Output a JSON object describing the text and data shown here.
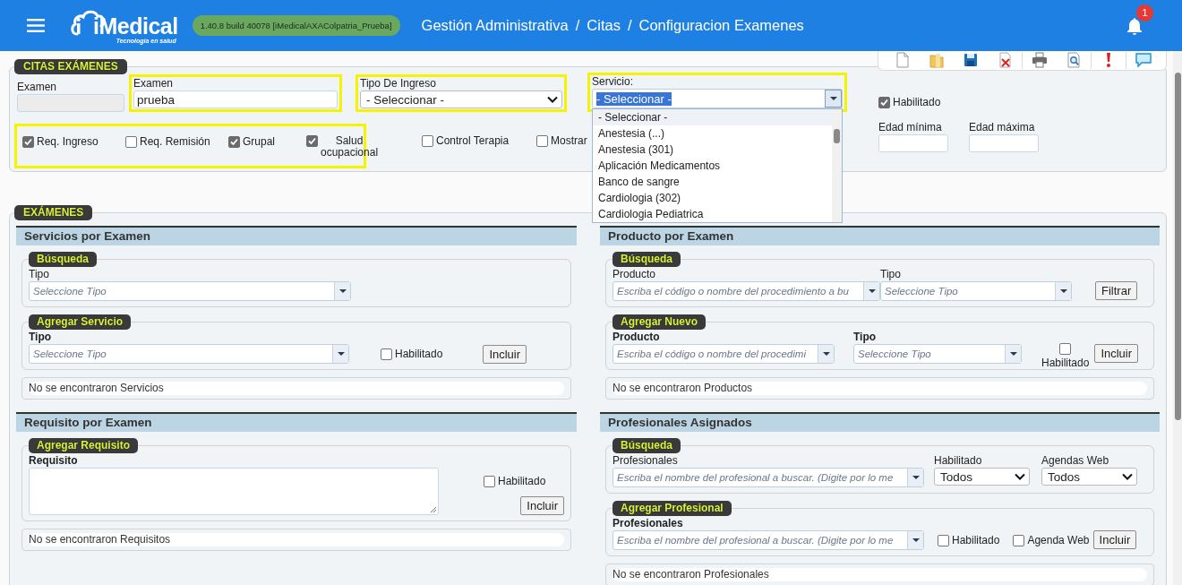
{
  "header": {
    "logo": "iMedical",
    "tagline": "Tecnología en salud",
    "version": "1.40.8 build 40078 [iMedicalAXAColpatria_Prueba]",
    "breadcrumb": [
      "Gestión Administrativa",
      "/",
      "Citas",
      "/",
      "Configuracion Examenes"
    ],
    "notification_count": "1"
  },
  "citas": {
    "legend": "CITAS EXÁMENES",
    "lines": [
      {
        "controls": [
          {
            "kind": "text",
            "label": "Examen",
            "disabled": true,
            "highlighted": false
          },
          {
            "kind": "text",
            "label": "Examen",
            "value": "prueba",
            "disabled": false,
            "highlighted": true
          },
          {
            "kind": "select",
            "label": "Tipo De Ingreso",
            "value": "- Seleccionar -",
            "highlighted": true
          },
          {
            "kind": "combo",
            "label": "Servicio:",
            "value": "- Seleccionar -",
            "text_selected": true,
            "highlighted": true,
            "expanded": true,
            "options": [
              {
                "label": "- Seleccionar -",
                "selected": true
              },
              {
                "label": "Anestesia (...)",
                "selected": false
              },
              {
                "label": "Anestesia (301)",
                "selected": false
              },
              {
                "label": "Aplicación Medicamentos",
                "selected": false
              },
              {
                "label": "Banco de sangre",
                "selected": false
              },
              {
                "label": "Cardiologia (302)",
                "selected": false
              },
              {
                "label": "Cardiologia Pediatrica",
                "selected": false
              }
            ]
          },
          {
            "kind": "check",
            "label": "Habilitado",
            "checked": true,
            "highlighted": false
          }
        ]
      },
      {
        "controls": [
          {
            "kind": "group",
            "highlighted": true,
            "items": [
              {
                "kind": "check",
                "label": "Req. Ingreso",
                "checked": true
              },
              {
                "kind": "check",
                "label": "Req. Remisión",
                "checked": false
              },
              {
                "kind": "check",
                "label": "Grupal",
                "checked": true
              },
              {
                "kind": "check",
                "label": "Salud ocupacional",
                "checked": true
              }
            ]
          },
          {
            "kind": "check",
            "label": "Control Terapia",
            "checked": false,
            "highlighted": false
          },
          {
            "kind": "check",
            "label": "Mostrar",
            "checked": false,
            "highlighted": false
          },
          {
            "kind": "text",
            "label": "Edad mínima",
            "disabled": false,
            "highlighted": false
          },
          {
            "kind": "text",
            "label": "Edad máxima",
            "disabled": false,
            "highlighted": false
          }
        ]
      }
    ]
  },
  "examenes": {
    "legend": "EXÁMENES",
    "columns": [
      [
        {
          "title": "Servicios por Examen",
          "groups": [
            {
              "legend": "Búsqueda",
              "kind": "search",
              "controls": [
                {
                  "kind": "combo",
                  "label": "Tipo",
                  "placeholder": "Seleccione Tipo",
                  "expanded": false
                }
              ]
            },
            {
              "legend": "Agregar Servicio",
              "kind": "add",
              "controls": [
                {
                  "kind": "combo",
                  "label": "Tipo",
                  "placeholder": "Seleccione Tipo",
                  "expanded": false
                },
                {
                  "kind": "check",
                  "label": "Habilitado",
                  "checked": false
                },
                {
                  "kind": "button",
                  "label": "Incluir"
                }
              ]
            }
          ],
          "result": "No se encontraron Servicios"
        },
        {
          "title": "Requisito por Examen",
          "groups": [
            {
              "legend": "Agregar Requisito",
              "kind": "add",
              "controls": [
                {
                  "kind": "textarea",
                  "label": "Requisito"
                },
                {
                  "kind": "check",
                  "label": "Habilitado",
                  "checked": false
                },
                {
                  "kind": "button",
                  "label": "Incluir"
                }
              ]
            }
          ],
          "result": "No se encontraron Requisitos"
        }
      ],
      [
        {
          "title": "Producto por Examen",
          "groups": [
            {
              "legend": "Búsqueda",
              "kind": "search",
              "controls": [
                {
                  "kind": "combo",
                  "label": "Producto",
                  "placeholder": "Escriba el código o nombre del procedimiento a bu",
                  "expanded": false
                },
                {
                  "kind": "combo",
                  "label": "Tipo",
                  "placeholder": "Seleccione Tipo",
                  "expanded": false
                },
                {
                  "kind": "button",
                  "label": "Filtrar"
                }
              ]
            },
            {
              "legend": "Agregar Nuevo",
              "kind": "add",
              "controls": [
                {
                  "kind": "combo",
                  "label": "Producto",
                  "placeholder": "Escriba el código o nombre del procedimi",
                  "expanded": false
                },
                {
                  "kind": "combo",
                  "label": "Tipo",
                  "placeholder": "Seleccione Tipo",
                  "expanded": false
                },
                {
                  "kind": "check",
                  "label": "Habilitado",
                  "checked": false
                },
                {
                  "kind": "button",
                  "label": "Incluir"
                }
              ]
            }
          ],
          "result": "No se encontraron Productos"
        },
        {
          "title": "Profesionales Asignados",
          "groups": [
            {
              "legend": "Búsqueda",
              "kind": "search",
              "controls": [
                {
                  "kind": "combo",
                  "label": "Profesionales",
                  "placeholder": "Escriba el nombre del profesional a buscar. (Digite por lo me",
                  "expanded": false
                },
                {
                  "kind": "select",
                  "label": "Habilitado",
                  "value": "Todos"
                },
                {
                  "kind": "select",
                  "label": "Agendas Web",
                  "value": "Todos"
                }
              ]
            },
            {
              "legend": "Agregar Profesional",
              "kind": "add",
              "controls": [
                {
                  "kind": "combo",
                  "label": "Profesionales",
                  "placeholder": "Escriba el nombre del profesional a buscar. (Digite por lo me",
                  "expanded": false
                },
                {
                  "kind": "check",
                  "label": "Habilitado",
                  "checked": false
                },
                {
                  "kind": "check",
                  "label": "Agenda Web",
                  "checked": false
                },
                {
                  "kind": "button",
                  "label": "Incluir"
                }
              ]
            }
          ],
          "result": "No se encontraron Profesionales"
        }
      ]
    ]
  }
}
